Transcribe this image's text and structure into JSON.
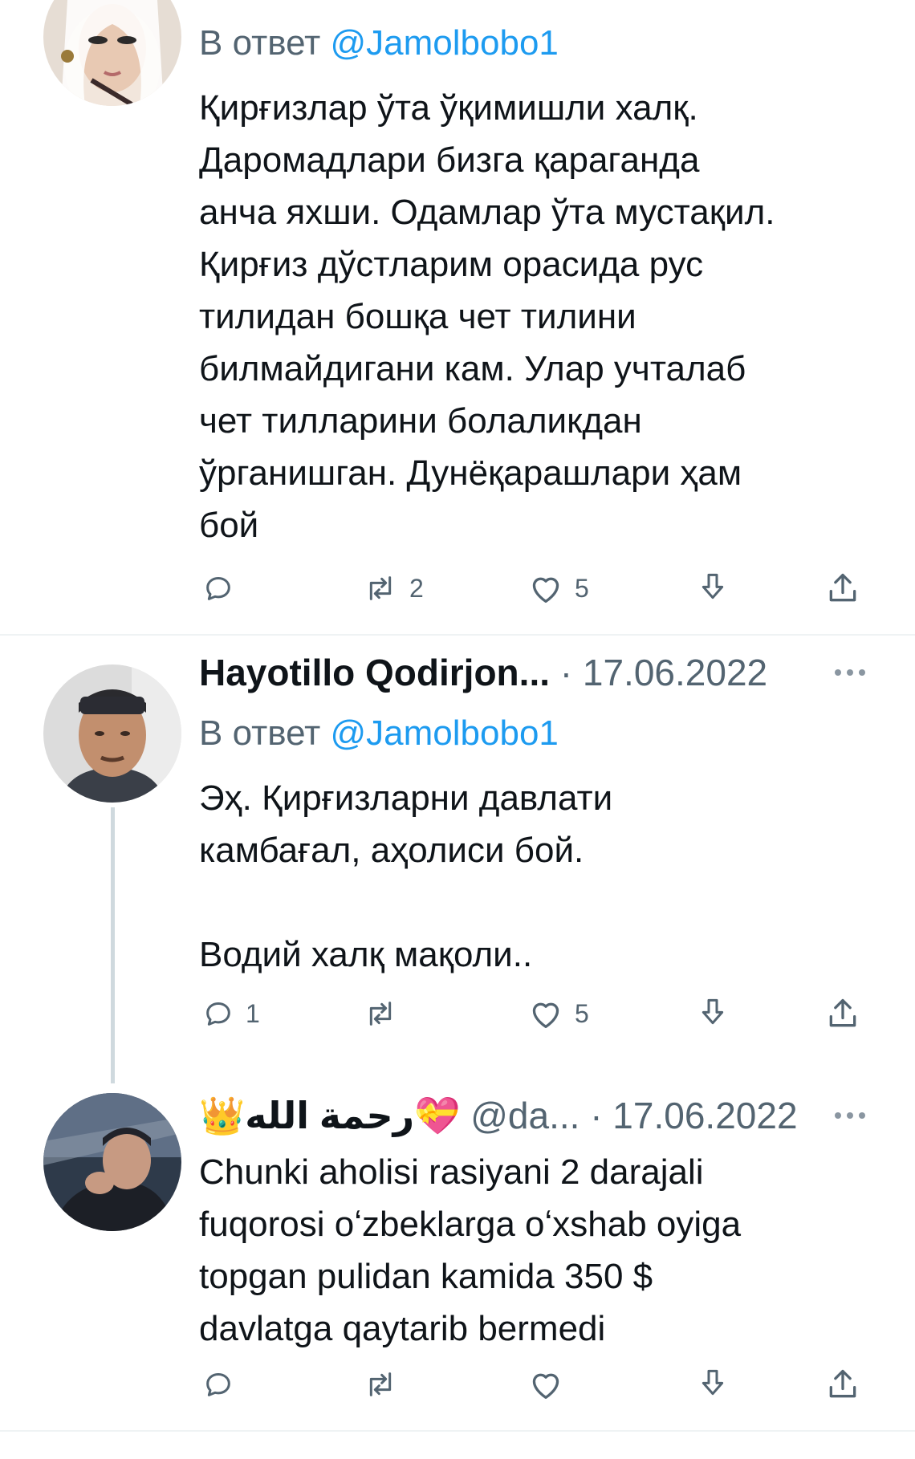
{
  "tweets": [
    {
      "reply_prefix": "В ответ",
      "reply_handle": "@Jamolbobo1",
      "text": "Қирғизлар ўта ўқимишли халқ.\nДаромадлари бизга қараганда\nанча яхши. Одамлар ўта мустақил.\nҚирғиз дўстларим орасида рус\nтилидан бошқа чет тилини\nбилмайдигани кам. Улар учталаб\nчет тилларини болаликдан\nўрганишган. Дунёқарашлари ҳам\nбой",
      "replies": "",
      "retweets": "2",
      "likes": "5"
    },
    {
      "name": "Hayotillo Qodirjon...",
      "date": "· 17.06.2022",
      "reply_prefix": "В ответ",
      "reply_handle": "@Jamolbobo1",
      "text": "Эҳ. Қирғизларни давлати\nкамбағал, аҳолиси бой.\n\nВодий халқ мақоли..",
      "replies": "1",
      "retweets": "",
      "likes": "5"
    },
    {
      "name": "👑رحمة الله",
      "name_suffix": "💝",
      "handle": "@da...",
      "date": "· 17.06.2022",
      "text": "Chunki aholisi rasiyani 2 darajali\nfuqorosi oʻzbeklarga oʻxshab oyiga\ntopgan pulidan kamida 350 $\ndavlatga qaytarib bermedi",
      "replies": "",
      "retweets": "",
      "likes": ""
    }
  ],
  "icons": [
    "reply-icon",
    "retweet-icon",
    "like-icon",
    "bookmark-icon",
    "share-icon",
    "more-icon"
  ],
  "colors": {
    "link": "#1d9bf0",
    "secondary_text": "#536471",
    "primary_text": "#0f1419",
    "divider": "#eff3f4",
    "thread_line": "#cfd9de"
  }
}
